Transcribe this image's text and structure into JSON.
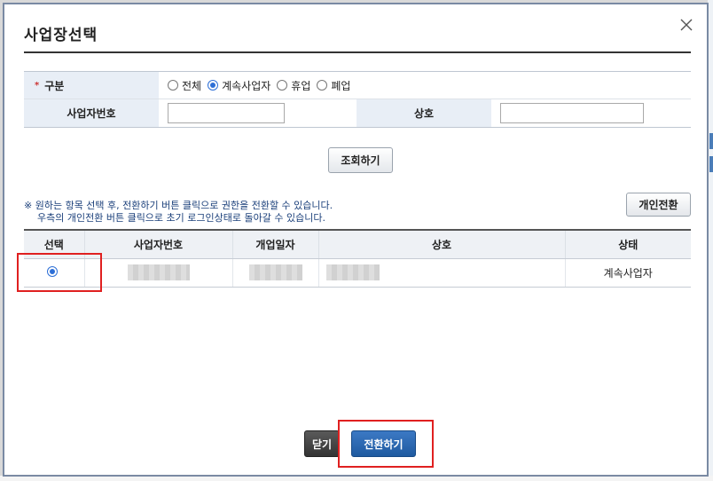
{
  "dialog": {
    "title": "사업장선택",
    "close_icon": "close-icon"
  },
  "form": {
    "type_label": "구분",
    "required_mark": "*",
    "type_options": [
      {
        "label": "전체",
        "checked": false
      },
      {
        "label": "계속사업자",
        "checked": true
      },
      {
        "label": "휴업",
        "checked": false
      },
      {
        "label": "폐업",
        "checked": false
      }
    ],
    "biz_no_label": "사업자번호",
    "biz_no_value": "",
    "company_label": "상호",
    "company_value": ""
  },
  "search_button": "조회하기",
  "notice": {
    "line1": "※ 원하는 항목 선택 후, 전환하기 버튼 클릭으로 권한을 전환할 수 있습니다.",
    "line2": "우측의 개인전환 버튼 클릭으로 초기 로그인상태로 돌아갈 수 있습니다."
  },
  "personal_button": "개인전환",
  "table": {
    "headers": [
      "선택",
      "사업자번호",
      "개업일자",
      "상호",
      "상태"
    ],
    "rows": [
      {
        "selected": true,
        "biz_no": "",
        "open_date": "",
        "company": "",
        "status": "계속사업자"
      }
    ]
  },
  "footer": {
    "close_label": "닫기",
    "switch_label": "전환하기"
  },
  "colors": {
    "accent": "#2d6fd6",
    "highlight": "#e02020",
    "primary_button": "#1f5aa0"
  }
}
